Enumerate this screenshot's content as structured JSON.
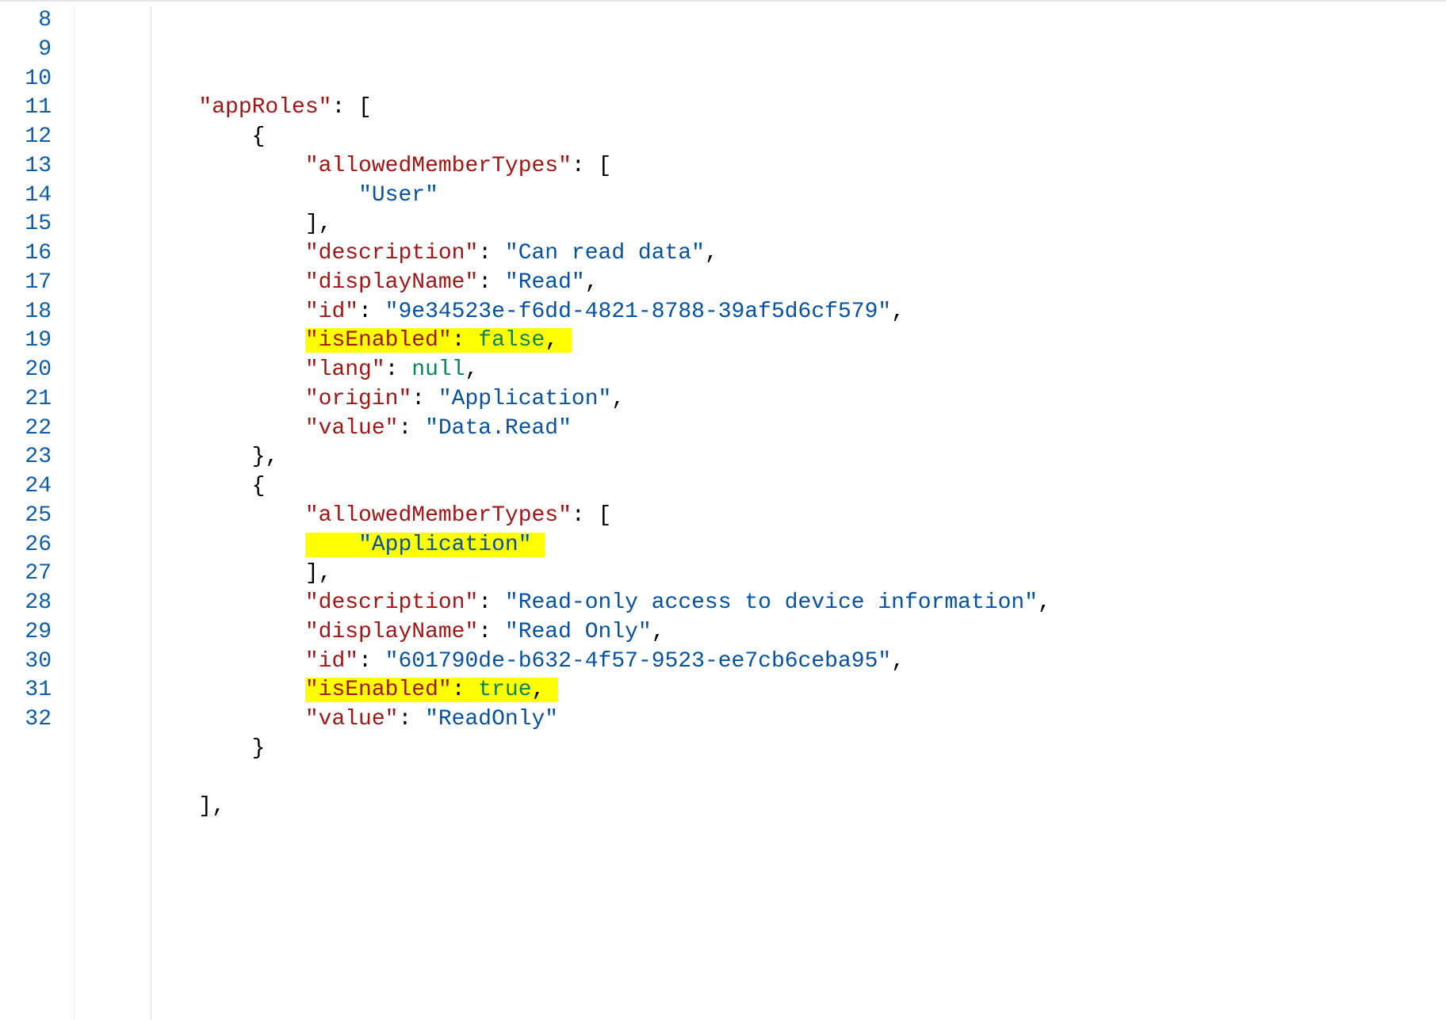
{
  "editor": {
    "first_line_number": 8,
    "lines": {
      "8": {
        "indent": "        ",
        "tokens": [
          {
            "t": "\"appRoles\"",
            "c": "k"
          },
          {
            "t": ": [",
            "c": "p"
          }
        ]
      },
      "9": {
        "indent": "            ",
        "tokens": [
          {
            "t": "{",
            "c": "p"
          }
        ]
      },
      "10": {
        "indent": "                ",
        "tokens": [
          {
            "t": "\"allowedMemberTypes\"",
            "c": "k"
          },
          {
            "t": ": [",
            "c": "p"
          }
        ]
      },
      "11": {
        "indent": "                    ",
        "tokens": [
          {
            "t": "\"User\"",
            "c": "s"
          }
        ]
      },
      "12": {
        "indent": "                ",
        "tokens": [
          {
            "t": "],",
            "c": "p"
          }
        ]
      },
      "13": {
        "indent": "                ",
        "tokens": [
          {
            "t": "\"description\"",
            "c": "k"
          },
          {
            "t": ": ",
            "c": "p"
          },
          {
            "t": "\"Can read data\"",
            "c": "s"
          },
          {
            "t": ",",
            "c": "p"
          }
        ]
      },
      "14": {
        "indent": "                ",
        "tokens": [
          {
            "t": "\"displayName\"",
            "c": "k"
          },
          {
            "t": ": ",
            "c": "p"
          },
          {
            "t": "\"Read\"",
            "c": "s"
          },
          {
            "t": ",",
            "c": "p"
          }
        ]
      },
      "15": {
        "indent": "                ",
        "tokens": [
          {
            "t": "\"id\"",
            "c": "k"
          },
          {
            "t": ": ",
            "c": "p"
          },
          {
            "t": "\"9e34523e-f6dd-4821-8788-39af5d6cf579\"",
            "c": "s"
          },
          {
            "t": ",",
            "c": "p"
          }
        ]
      },
      "16": {
        "indent": "                ",
        "hl": true,
        "tokens": [
          {
            "t": "\"isEnabled\"",
            "c": "k"
          },
          {
            "t": ": ",
            "c": "p"
          },
          {
            "t": "false",
            "c": "n"
          },
          {
            "t": ",",
            "c": "p"
          }
        ]
      },
      "17": {
        "indent": "                ",
        "tokens": [
          {
            "t": "\"lang\"",
            "c": "k"
          },
          {
            "t": ": ",
            "c": "p"
          },
          {
            "t": "null",
            "c": "n"
          },
          {
            "t": ",",
            "c": "p"
          }
        ]
      },
      "18": {
        "indent": "                ",
        "tokens": [
          {
            "t": "\"origin\"",
            "c": "k"
          },
          {
            "t": ": ",
            "c": "p"
          },
          {
            "t": "\"Application\"",
            "c": "s"
          },
          {
            "t": ",",
            "c": "p"
          }
        ]
      },
      "19": {
        "indent": "                ",
        "tokens": [
          {
            "t": "\"value\"",
            "c": "k"
          },
          {
            "t": ": ",
            "c": "p"
          },
          {
            "t": "\"Data.Read\"",
            "c": "s"
          }
        ]
      },
      "20": {
        "indent": "            ",
        "tokens": [
          {
            "t": "},",
            "c": "p"
          }
        ]
      },
      "21": {
        "indent": "            ",
        "tokens": [
          {
            "t": "{",
            "c": "p"
          }
        ]
      },
      "22": {
        "indent": "                ",
        "tokens": [
          {
            "t": "\"allowedMemberTypes\"",
            "c": "k"
          },
          {
            "t": ": [",
            "c": "p"
          }
        ]
      },
      "23": {
        "indent": "                ",
        "hl_inner": true,
        "hl_pad": "    ",
        "tokens": [
          {
            "t": "\"Application\"",
            "c": "s"
          }
        ]
      },
      "24": {
        "indent": "                ",
        "tokens": [
          {
            "t": "],",
            "c": "p"
          }
        ]
      },
      "25": {
        "indent": "                ",
        "tokens": [
          {
            "t": "\"description\"",
            "c": "k"
          },
          {
            "t": ": ",
            "c": "p"
          },
          {
            "t": "\"Read-only access to device information\"",
            "c": "s"
          },
          {
            "t": ",",
            "c": "p"
          }
        ]
      },
      "26": {
        "indent": "                ",
        "tokens": [
          {
            "t": "\"displayName\"",
            "c": "k"
          },
          {
            "t": ": ",
            "c": "p"
          },
          {
            "t": "\"Read Only\"",
            "c": "s"
          },
          {
            "t": ",",
            "c": "p"
          }
        ]
      },
      "27": {
        "indent": "                ",
        "tokens": [
          {
            "t": "\"id\"",
            "c": "k"
          },
          {
            "t": ": ",
            "c": "p"
          },
          {
            "t": "\"601790de-b632-4f57-9523-ee7cb6ceba95\"",
            "c": "s"
          },
          {
            "t": ",",
            "c": "p"
          }
        ]
      },
      "28": {
        "indent": "                ",
        "hl": true,
        "tokens": [
          {
            "t": "\"isEnabled\"",
            "c": "k"
          },
          {
            "t": ": ",
            "c": "p"
          },
          {
            "t": "true",
            "c": "n"
          },
          {
            "t": ",",
            "c": "p"
          }
        ]
      },
      "29": {
        "indent": "                ",
        "tokens": [
          {
            "t": "\"value\"",
            "c": "k"
          },
          {
            "t": ": ",
            "c": "p"
          },
          {
            "t": "\"ReadOnly\"",
            "c": "s"
          }
        ]
      },
      "30": {
        "indent": "            ",
        "tokens": [
          {
            "t": "}",
            "c": "p"
          }
        ]
      },
      "31": {
        "indent": "",
        "tokens": []
      },
      "32": {
        "indent": "        ",
        "tokens": [
          {
            "t": "],",
            "c": "p"
          }
        ]
      }
    }
  }
}
